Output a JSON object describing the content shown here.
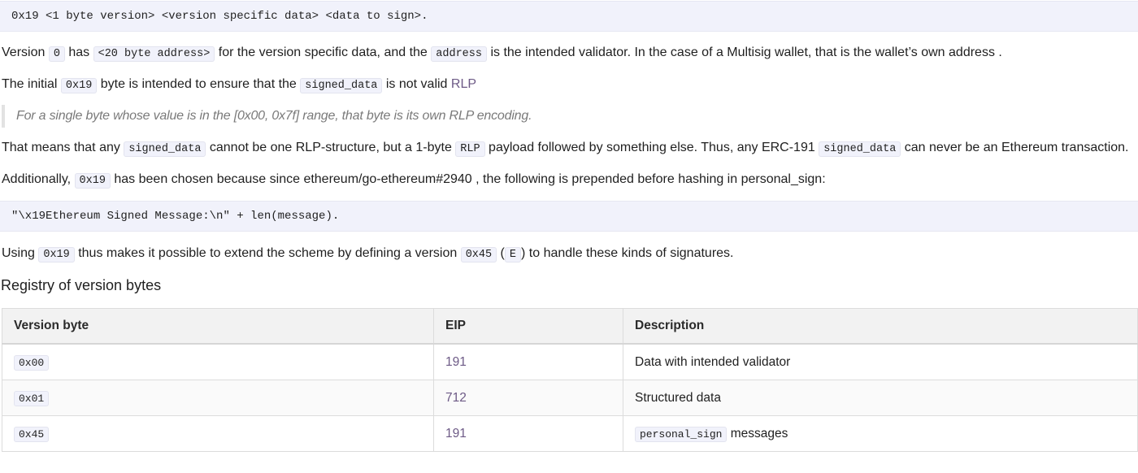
{
  "block1": "0x19 <1 byte version> <version specific data> <data to sign>.",
  "p1": {
    "t1": "Version ",
    "c1": "0",
    "t2": " has ",
    "c2": "<20 byte address>",
    "t3": " for the version specific data, and the ",
    "c3": "address",
    "t4": " is the intended validator. In the case of a Multisig wallet, that is the wallet’s own address ."
  },
  "p2": {
    "t1": "The initial ",
    "c1": "0x19",
    "t2": " byte is intended to ensure that the ",
    "c2": "signed_data",
    "t3": " is not valid ",
    "link": "RLP"
  },
  "quote": "For a single byte whose value is in the [0x00, 0x7f] range, that byte is its own RLP encoding.",
  "p3": {
    "t1": "That means that any ",
    "c1": "signed_data",
    "t2": " cannot be one RLP-structure, but a 1-byte ",
    "c2": "RLP",
    "t3": " payload followed by something else. Thus, any ERC-191 ",
    "c3": "signed_data",
    "t4": " can never be an Ethereum transaction."
  },
  "p4": {
    "t1": "Additionally, ",
    "c1": "0x19",
    "t2": " has been chosen because since ethereum/go-ethereum#2940 , the following is prepended before hashing in personal_sign:"
  },
  "block2": "\"\\x19Ethereum Signed Message:\\n\" + len(message).",
  "p5": {
    "t1": "Using ",
    "c1": "0x19",
    "t2": " thus makes it possible to extend the scheme by defining a version ",
    "c2": "0x45",
    "t3": " (",
    "c3": "E",
    "t4": ") to handle these kinds of signatures."
  },
  "registry": {
    "heading": "Registry of version bytes",
    "headers": [
      "Version byte",
      "EIP",
      "Description"
    ],
    "rows": [
      {
        "byte": "0x00",
        "eip": "191",
        "desc": "Data with intended validator"
      },
      {
        "byte": "0x01",
        "eip": "712",
        "desc": "Structured data"
      },
      {
        "byte": "0x45",
        "eip": "191",
        "desc_code": "personal_sign",
        "desc": " messages"
      }
    ]
  },
  "colors": {
    "link": "#6d5a86",
    "code_bg": "#f1f2fb"
  }
}
